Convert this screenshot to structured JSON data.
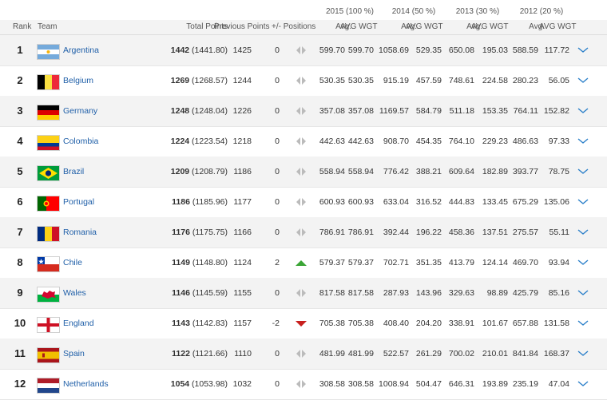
{
  "header": {
    "years": [
      {
        "label": "2015 (100 %)"
      },
      {
        "label": "2014 (50 %)"
      },
      {
        "label": "2013 (30 %)"
      },
      {
        "label": "2012 (20 %)"
      }
    ],
    "columns": {
      "rank": "Rank",
      "team": "Team",
      "total_points": "Total Points",
      "previous_points": "Previous Points",
      "positions": "+/- Positions",
      "avg": "Avg.",
      "avg_wgt": "AVG WGT"
    }
  },
  "rows": [
    {
      "rank": "1",
      "team": "Argentina",
      "flag": "argentina",
      "total_bold": "1442",
      "total_exact": "(1441.80)",
      "previous": "1425",
      "change": "0",
      "trend": "same",
      "y2015_avg": "599.70",
      "y2015_wgt": "599.70",
      "y2014_avg": "1058.69",
      "y2014_wgt": "529.35",
      "y2013_avg": "650.08",
      "y2013_wgt": "195.03",
      "y2012_avg": "588.59",
      "y2012_wgt": "117.72"
    },
    {
      "rank": "2",
      "team": "Belgium",
      "flag": "belgium",
      "total_bold": "1269",
      "total_exact": "(1268.57)",
      "previous": "1244",
      "change": "0",
      "trend": "same",
      "y2015_avg": "530.35",
      "y2015_wgt": "530.35",
      "y2014_avg": "915.19",
      "y2014_wgt": "457.59",
      "y2013_avg": "748.61",
      "y2013_wgt": "224.58",
      "y2012_avg": "280.23",
      "y2012_wgt": "56.05"
    },
    {
      "rank": "3",
      "team": "Germany",
      "flag": "germany",
      "total_bold": "1248",
      "total_exact": "(1248.04)",
      "previous": "1226",
      "change": "0",
      "trend": "same",
      "y2015_avg": "357.08",
      "y2015_wgt": "357.08",
      "y2014_avg": "1169.57",
      "y2014_wgt": "584.79",
      "y2013_avg": "511.18",
      "y2013_wgt": "153.35",
      "y2012_avg": "764.11",
      "y2012_wgt": "152.82"
    },
    {
      "rank": "4",
      "team": "Colombia",
      "flag": "colombia",
      "total_bold": "1224",
      "total_exact": "(1223.54)",
      "previous": "1218",
      "change": "0",
      "trend": "same",
      "y2015_avg": "442.63",
      "y2015_wgt": "442.63",
      "y2014_avg": "908.70",
      "y2014_wgt": "454.35",
      "y2013_avg": "764.10",
      "y2013_wgt": "229.23",
      "y2012_avg": "486.63",
      "y2012_wgt": "97.33"
    },
    {
      "rank": "5",
      "team": "Brazil",
      "flag": "brazil",
      "total_bold": "1209",
      "total_exact": "(1208.79)",
      "previous": "1186",
      "change": "0",
      "trend": "same",
      "y2015_avg": "558.94",
      "y2015_wgt": "558.94",
      "y2014_avg": "776.42",
      "y2014_wgt": "388.21",
      "y2013_avg": "609.64",
      "y2013_wgt": "182.89",
      "y2012_avg": "393.77",
      "y2012_wgt": "78.75"
    },
    {
      "rank": "6",
      "team": "Portugal",
      "flag": "portugal",
      "total_bold": "1186",
      "total_exact": "(1185.96)",
      "previous": "1177",
      "change": "0",
      "trend": "same",
      "y2015_avg": "600.93",
      "y2015_wgt": "600.93",
      "y2014_avg": "633.04",
      "y2014_wgt": "316.52",
      "y2013_avg": "444.83",
      "y2013_wgt": "133.45",
      "y2012_avg": "675.29",
      "y2012_wgt": "135.06"
    },
    {
      "rank": "7",
      "team": "Romania",
      "flag": "romania",
      "total_bold": "1176",
      "total_exact": "(1175.75)",
      "previous": "1166",
      "change": "0",
      "trend": "same",
      "y2015_avg": "786.91",
      "y2015_wgt": "786.91",
      "y2014_avg": "392.44",
      "y2014_wgt": "196.22",
      "y2013_avg": "458.36",
      "y2013_wgt": "137.51",
      "y2012_avg": "275.57",
      "y2012_wgt": "55.11"
    },
    {
      "rank": "8",
      "team": "Chile",
      "flag": "chile",
      "total_bold": "1149",
      "total_exact": "(1148.80)",
      "previous": "1124",
      "change": "2",
      "trend": "up",
      "y2015_avg": "579.37",
      "y2015_wgt": "579.37",
      "y2014_avg": "702.71",
      "y2014_wgt": "351.35",
      "y2013_avg": "413.79",
      "y2013_wgt": "124.14",
      "y2012_avg": "469.70",
      "y2012_wgt": "93.94"
    },
    {
      "rank": "9",
      "team": "Wales",
      "flag": "wales",
      "total_bold": "1146",
      "total_exact": "(1145.59)",
      "previous": "1155",
      "change": "0",
      "trend": "same",
      "y2015_avg": "817.58",
      "y2015_wgt": "817.58",
      "y2014_avg": "287.93",
      "y2014_wgt": "143.96",
      "y2013_avg": "329.63",
      "y2013_wgt": "98.89",
      "y2012_avg": "425.79",
      "y2012_wgt": "85.16"
    },
    {
      "rank": "10",
      "team": "England",
      "flag": "england",
      "total_bold": "1143",
      "total_exact": "(1142.83)",
      "previous": "1157",
      "change": "-2",
      "trend": "down",
      "y2015_avg": "705.38",
      "y2015_wgt": "705.38",
      "y2014_avg": "408.40",
      "y2014_wgt": "204.20",
      "y2013_avg": "338.91",
      "y2013_wgt": "101.67",
      "y2012_avg": "657.88",
      "y2012_wgt": "131.58"
    },
    {
      "rank": "11",
      "team": "Spain",
      "flag": "spain",
      "total_bold": "1122",
      "total_exact": "(1121.66)",
      "previous": "1110",
      "change": "0",
      "trend": "same",
      "y2015_avg": "481.99",
      "y2015_wgt": "481.99",
      "y2014_avg": "522.57",
      "y2014_wgt": "261.29",
      "y2013_avg": "700.02",
      "y2013_wgt": "210.01",
      "y2012_avg": "841.84",
      "y2012_wgt": "168.37"
    },
    {
      "rank": "12",
      "team": "Netherlands",
      "flag": "netherlands",
      "total_bold": "1054",
      "total_exact": "(1053.98)",
      "previous": "1032",
      "change": "0",
      "trend": "same",
      "y2015_avg": "308.58",
      "y2015_wgt": "308.58",
      "y2014_avg": "1008.94",
      "y2014_wgt": "504.47",
      "y2013_avg": "646.31",
      "y2013_wgt": "193.89",
      "y2012_avg": "235.19",
      "y2012_wgt": "47.04"
    }
  ],
  "colors": {
    "link": "#1f5fa8",
    "up": "#3aa535",
    "down": "#c8201e",
    "chevron": "#2a7fc9",
    "row_alt": "#f3f3f3"
  }
}
